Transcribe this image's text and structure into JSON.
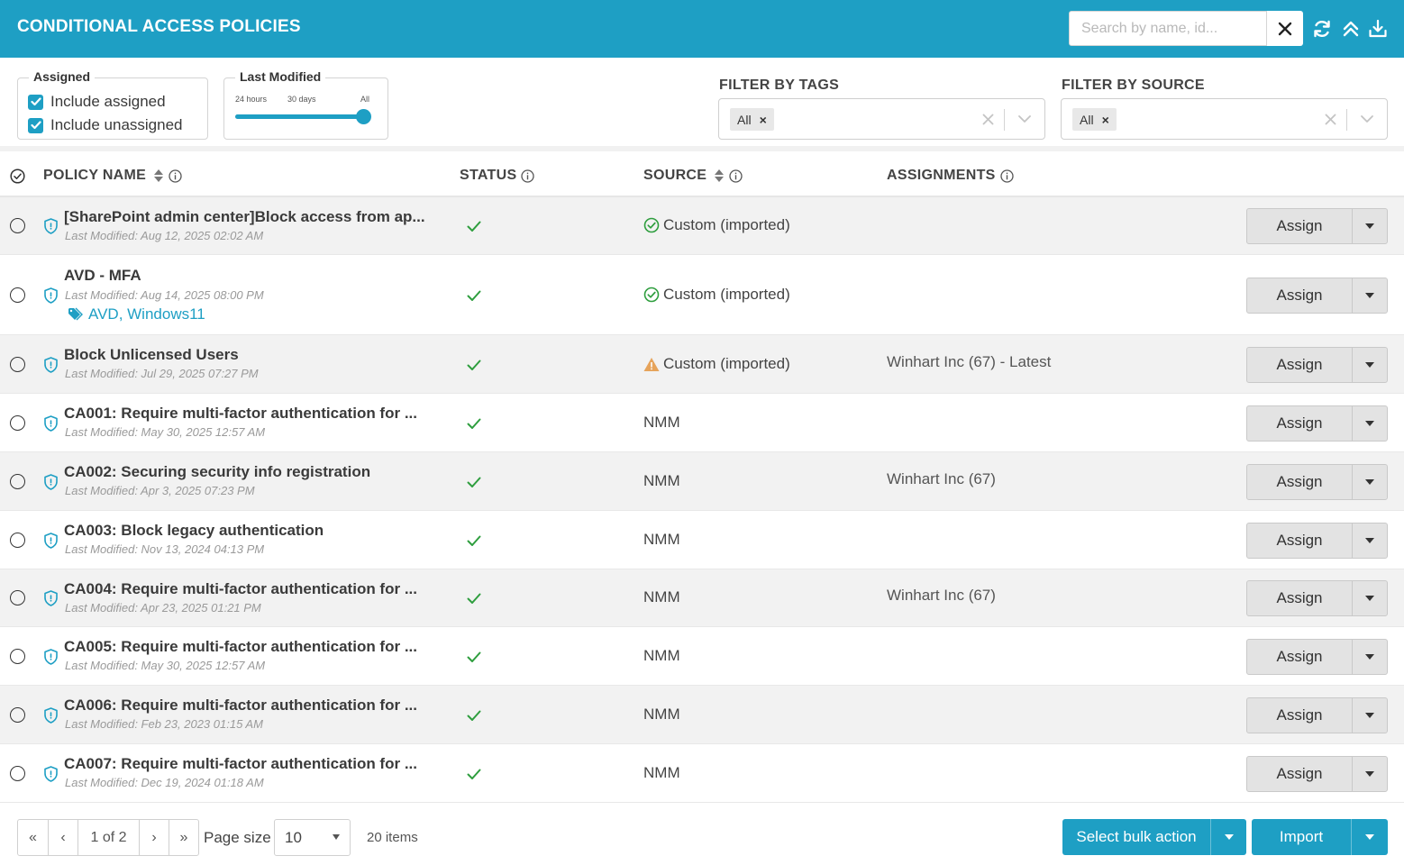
{
  "header": {
    "title": "CONDITIONAL ACCESS POLICIES",
    "search_placeholder": "Search by name, id...",
    "search_value": ""
  },
  "filters": {
    "assigned": {
      "legend": "Assigned",
      "include_assigned_label": "Include assigned",
      "include_assigned_checked": true,
      "include_unassigned_label": "Include unassigned",
      "include_unassigned_checked": true
    },
    "last_modified": {
      "legend": "Last Modified",
      "tick_24h": "24 hours",
      "tick_30d": "30 days",
      "tick_all": "All",
      "selected": "All"
    },
    "tags": {
      "title": "FILTER BY TAGS",
      "chip": "All"
    },
    "source": {
      "title": "FILTER BY SOURCE",
      "chip": "All"
    }
  },
  "table": {
    "columns": {
      "policy_name": "POLICY NAME",
      "status": "STATUS",
      "source": "SOURCE",
      "assignments": "ASSIGNMENTS"
    },
    "rows": [
      {
        "name": "[SharePoint admin center]Block access from ap...",
        "modified": "Last Modified: Aug 12, 2025 02:02 AM",
        "tags": "",
        "status": "enabled",
        "source": "Custom (imported)",
        "source_icon": "check-circle-icon",
        "assignment": "",
        "action": "Assign"
      },
      {
        "name": "AVD - MFA",
        "modified": "Last Modified: Aug 14, 2025 08:00 PM",
        "tags": "AVD, Windows11",
        "status": "enabled",
        "source": "Custom (imported)",
        "source_icon": "check-circle-icon",
        "assignment": "",
        "action": "Assign"
      },
      {
        "name": "Block Unlicensed Users",
        "modified": "Last Modified: Jul 29, 2025 07:27 PM",
        "tags": "",
        "status": "enabled",
        "source": "Custom (imported)",
        "source_icon": "warning-icon",
        "assignment": "Winhart Inc (67) - Latest",
        "action": "Assign"
      },
      {
        "name": "CA001: Require multi-factor authentication for ...",
        "modified": "Last Modified: May 30, 2025 12:57 AM",
        "tags": "",
        "status": "enabled",
        "source": "NMM",
        "source_icon": "",
        "assignment": "",
        "action": "Assign"
      },
      {
        "name": "CA002: Securing security info registration",
        "modified": "Last Modified: Apr 3, 2025 07:23 PM",
        "tags": "",
        "status": "enabled",
        "source": "NMM",
        "source_icon": "",
        "assignment": "Winhart Inc (67)",
        "action": "Assign"
      },
      {
        "name": "CA003: Block legacy authentication",
        "modified": "Last Modified: Nov 13, 2024 04:13 PM",
        "tags": "",
        "status": "enabled",
        "source": "NMM",
        "source_icon": "",
        "assignment": "",
        "action": "Assign"
      },
      {
        "name": "CA004: Require multi-factor authentication for ...",
        "modified": "Last Modified: Apr 23, 2025 01:21 PM",
        "tags": "",
        "status": "enabled",
        "source": "NMM",
        "source_icon": "",
        "assignment": "Winhart Inc (67)",
        "action": "Assign"
      },
      {
        "name": "CA005: Require multi-factor authentication for ...",
        "modified": "Last Modified: May 30, 2025 12:57 AM",
        "tags": "",
        "status": "enabled",
        "source": "NMM",
        "source_icon": "",
        "assignment": "",
        "action": "Assign"
      },
      {
        "name": "CA006: Require multi-factor authentication for ...",
        "modified": "Last Modified: Feb 23, 2023 01:15 AM",
        "tags": "",
        "status": "enabled",
        "source": "NMM",
        "source_icon": "",
        "assignment": "",
        "action": "Assign"
      },
      {
        "name": "CA007: Require multi-factor authentication for ...",
        "modified": "Last Modified: Dec 19, 2024 01:18 AM",
        "tags": "",
        "status": "enabled",
        "source": "NMM",
        "source_icon": "",
        "assignment": "",
        "action": "Assign"
      }
    ]
  },
  "footer": {
    "first": "«",
    "prev": "‹",
    "page_info": "1 of 2",
    "next": "›",
    "last": "»",
    "page_size_label": "Page size",
    "page_size_value": "10",
    "items_count": "20 items",
    "bulk_action_label": "Select bulk action",
    "import_label": "Import"
  },
  "colors": {
    "accent": "#1e9fc4",
    "success": "#2e9e3e",
    "warning": "#e6a35a",
    "tag": "#1e9fc4"
  }
}
